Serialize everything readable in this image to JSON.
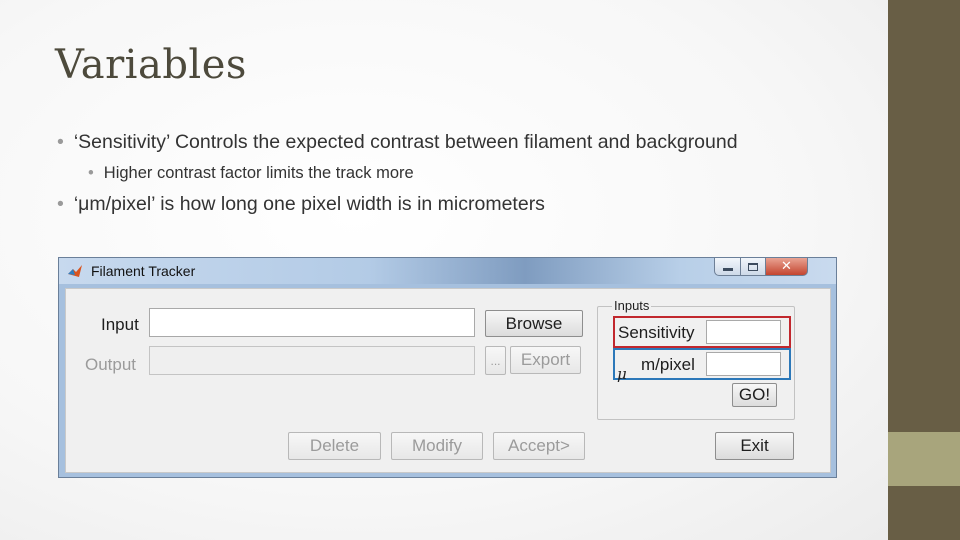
{
  "slide": {
    "title": "Variables",
    "bullets": [
      "‘Sensitivity’ Controls the expected contrast between filament and background",
      "Higher contrast factor limits the track more",
      "‘μm/pixel’ is how long one pixel width is in micrometers"
    ],
    "bullet_marker": "•",
    "colors": {
      "title": "#4d4a3c",
      "side_bar": "#685e45",
      "side_accent": "#a8a57c",
      "highlight_red": "#c1272d",
      "highlight_blue": "#2c78b9"
    }
  },
  "window": {
    "title": "Filament Tracker",
    "app_icon": "matlab-icon",
    "controls": {
      "minimize": "minimize-icon",
      "maximize": "maximize-icon",
      "close": "close-icon",
      "close_glyph": "✕"
    }
  },
  "form": {
    "input_label": "Input",
    "input_value": "",
    "output_label": "Output",
    "output_value": "",
    "browse_label": "Browse",
    "ellipsis_label": "...",
    "export_label": "Export",
    "inputs_group": {
      "legend": "Inputs",
      "sensitivity_label": "Sensitivity",
      "sensitivity_value": "",
      "mu_symbol": "μ",
      "mpixel_label": "m/pixel",
      "mpixel_value": "",
      "go_label": "GO!"
    },
    "delete_label": "Delete",
    "modify_label": "Modify",
    "accept_label": "Accept>",
    "exit_label": "Exit"
  }
}
